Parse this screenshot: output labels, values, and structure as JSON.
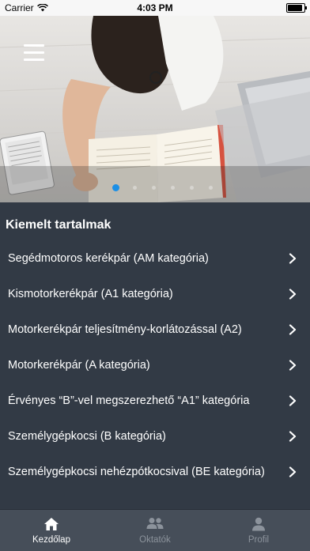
{
  "status_bar": {
    "carrier": "Carrier",
    "time": "4:03 PM"
  },
  "carousel": {
    "page_count": 6,
    "active_index": 0
  },
  "featured": {
    "title": "Kiemelt tartalmak",
    "items": [
      {
        "label": "Segédmotoros kerékpár (AM kategória)"
      },
      {
        "label": "Kismotorkerékpár (A1 kategória)"
      },
      {
        "label": "Motorkerékpár teljesítmény-korlátozással (A2)"
      },
      {
        "label": "Motorkerékpár (A kategória)"
      },
      {
        "label": "Érvényes “B”-vel megszerezhető “A1” kategória"
      },
      {
        "label": "Személygépkocsi (B kategória)"
      },
      {
        "label": "Személygépkocsi nehézpótkocsival (BE kategória)"
      }
    ]
  },
  "tabbar": {
    "tabs": [
      {
        "label": "Kezdőlap",
        "icon": "home-icon",
        "active": true
      },
      {
        "label": "Oktatók",
        "icon": "people-icon",
        "active": false
      },
      {
        "label": "Profil",
        "icon": "person-icon",
        "active": false
      }
    ]
  },
  "colors": {
    "background": "#323a45",
    "tabbar": "#464e59",
    "accent": "#1b8fe6"
  }
}
